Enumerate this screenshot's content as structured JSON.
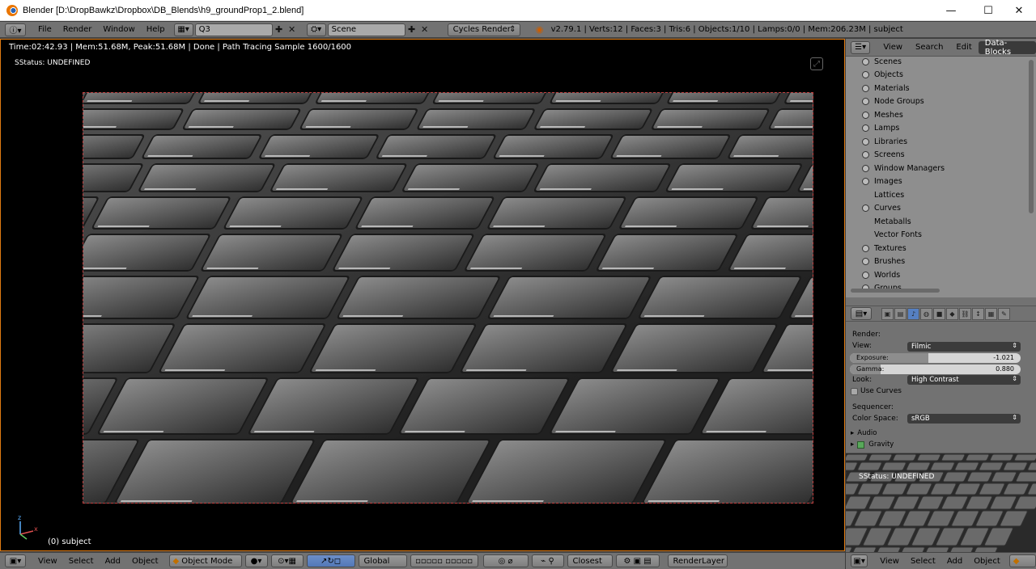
{
  "window": {
    "title": "Blender [D:\\DropBawkz\\Dropbox\\DB_Blends\\h9_groundProp1_2.blend]",
    "minimize_glyph": "—",
    "maximize_glyph": "☐",
    "close_glyph": "✕"
  },
  "info_header": {
    "menus": [
      "File",
      "Render",
      "Window",
      "Help"
    ],
    "screen_layout": "Q3",
    "scene": "Scene",
    "render_engine": "Cycles Render",
    "stats": "v2.79.1 | Verts:12 | Faces:3 | Tris:6 | Objects:1/10 | Lamps:0/0 | Mem:206.23M | subject"
  },
  "viewport": {
    "render_info": "Time:02:42.93 | Mem:51.68M, Peak:51.68M | Done | Path Tracing Sample 1600/1600",
    "status": "SStatus: UNDEFINED",
    "object_label": "(0) subject",
    "axis_labels": {
      "x": "x",
      "z": "z"
    }
  },
  "view3d_header": {
    "menus": [
      "View",
      "Select",
      "Add",
      "Object"
    ],
    "mode": "Object Mode",
    "orientation": "Global",
    "snap": "Closest",
    "render_layer": "RenderLayer"
  },
  "outliner": {
    "tabs": [
      "View",
      "Search",
      "Edit",
      "Data-Blocks"
    ],
    "active_tab": "Data-Blocks",
    "items": [
      {
        "label": "Scenes",
        "expand": true
      },
      {
        "label": "Objects",
        "expand": true
      },
      {
        "label": "Materials",
        "expand": true
      },
      {
        "label": "Node Groups",
        "expand": true
      },
      {
        "label": "Meshes",
        "expand": true
      },
      {
        "label": "Lamps",
        "expand": true
      },
      {
        "label": "Libraries",
        "expand": true
      },
      {
        "label": "Screens",
        "expand": true
      },
      {
        "label": "Window Managers",
        "expand": true
      },
      {
        "label": "Images",
        "expand": true
      },
      {
        "label": "Lattices",
        "expand": false
      },
      {
        "label": "Curves",
        "expand": true
      },
      {
        "label": "Metaballs",
        "expand": false
      },
      {
        "label": "Vector Fonts",
        "expand": false
      },
      {
        "label": "Textures",
        "expand": true
      },
      {
        "label": "Brushes",
        "expand": true
      },
      {
        "label": "Worlds",
        "expand": true
      },
      {
        "label": "Groups",
        "expand": true
      }
    ]
  },
  "properties": {
    "render_label": "Render:",
    "view_label": "View:",
    "view_value": "Filmic",
    "exposure_label": "Exposure:",
    "exposure_value": "-1.021",
    "gamma_label": "Gamma:",
    "gamma_value": "0.880",
    "look_label": "Look:",
    "look_value": "High Contrast",
    "use_curves_label": "Use Curves",
    "sequencer_label": "Sequencer:",
    "color_space_label": "Color Space:",
    "color_space_value": "sRGB",
    "audio_panel": "Audio",
    "gravity_panel": "Gravity"
  },
  "preview": {
    "status": "SStatus: UNDEFINED"
  },
  "right_header": {
    "menus": [
      "View",
      "Select",
      "Add",
      "Object"
    ]
  },
  "colors": {
    "accent_border": "#e07b12",
    "header_bg": "#727272",
    "outliner_bg": "#8e8e8e",
    "active_tab": "#3a3a3a"
  }
}
